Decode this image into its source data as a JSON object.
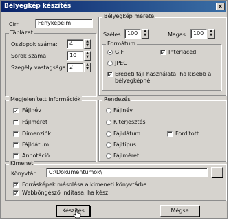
{
  "window": {
    "title": "Bélyegkép készítés",
    "close": "×"
  },
  "main": {
    "cim_label": "Cím",
    "cim_value": "Fényképeim",
    "tablazat": {
      "title": "Táblázat",
      "oszlopok_label": "Oszlopok száma:",
      "oszlopok_value": "4",
      "sorok_label": "Sorok száma:",
      "sorok_value": "10",
      "szegely_label": "Szegély vastagsága:",
      "szegely_value": "2"
    },
    "meret": {
      "title": "Bélyegkép mérete",
      "szeles_label": "Széles:",
      "szeles_value": "100",
      "magas_label": "Magas:",
      "magas_value": "100"
    },
    "formatum": {
      "title": "Formátum",
      "gif": "GIF",
      "jpeg": "JPEG",
      "interlaced": "Interlaced",
      "eredeti_line1": "Eredeti fájl használata, ha kisebb a",
      "eredeti_line2": "bélyegképnél"
    },
    "info": {
      "title": "Megjelenített információk",
      "items": [
        "Fájlnév",
        "Fájlméret",
        "Dimenziók",
        "Fájldátum",
        "Annotáció"
      ]
    },
    "rendezes": {
      "title": "Rendezés",
      "items": [
        "Fájlnév",
        "Kiterjesztés",
        "Fájldátum",
        "Fájltípus",
        "Fájlméret"
      ],
      "forditott": "Fordított"
    },
    "kimenet": {
      "title": "Kimenet",
      "konyvtar_label": "Könyvtár:",
      "konyvtar_value": "C:\\Dokumentumok\\",
      "browse": "...",
      "masolas": "Forrásképek másolása a kimeneti könyvtárba",
      "bongeszo": "Webböngésző indítása, ha kész"
    },
    "buttons": {
      "keszites": "Készítés",
      "megse": "Mégse"
    }
  }
}
